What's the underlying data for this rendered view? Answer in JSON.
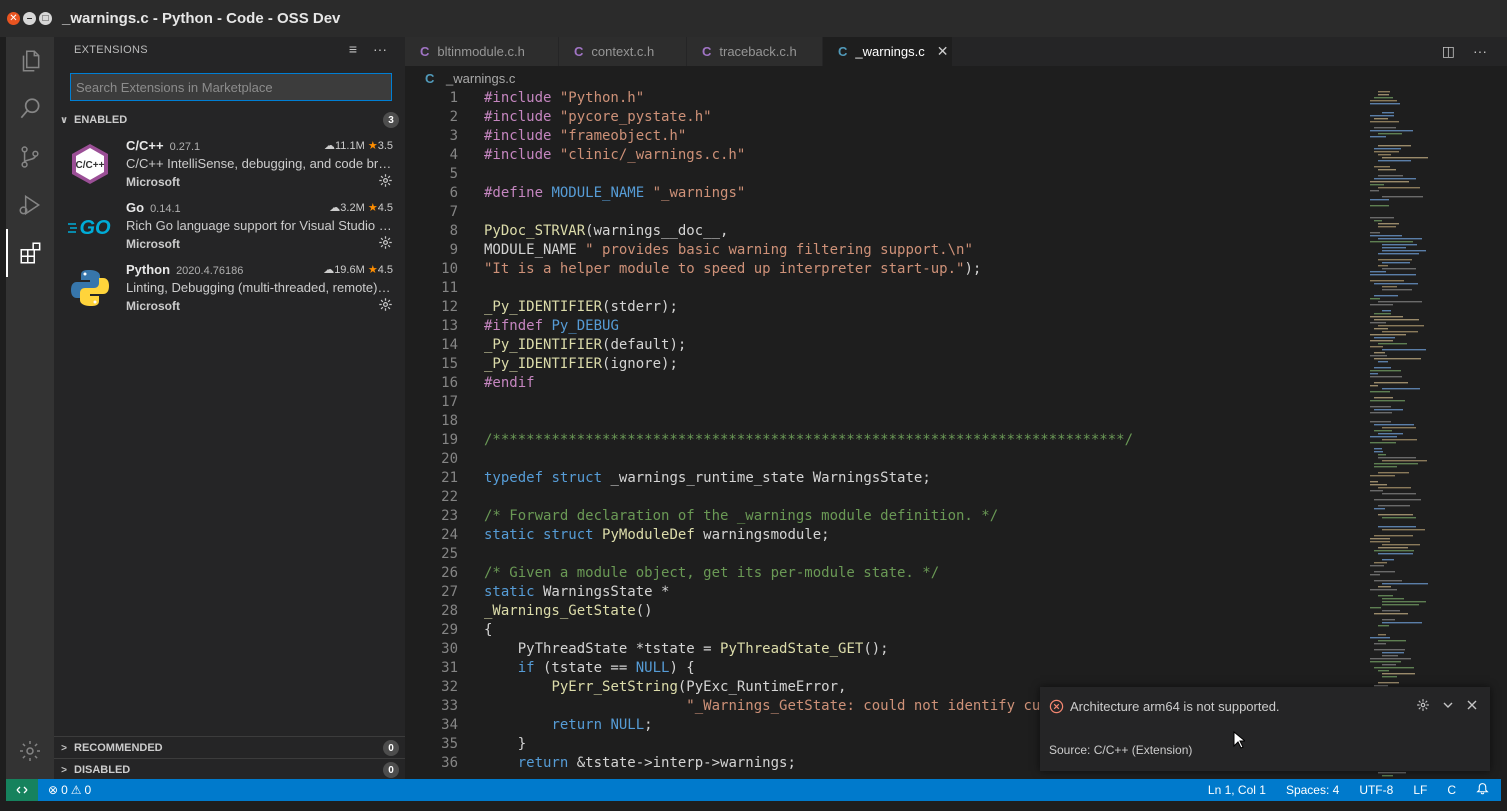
{
  "window": {
    "title": "_warnings.c - Python - Code - OSS Dev"
  },
  "activity_bar": {
    "items": [
      "explorer-icon",
      "search-icon",
      "source-control-icon",
      "run-debug-icon",
      "extensions-icon"
    ],
    "bottom": "manage-gear-icon"
  },
  "sidebar": {
    "header": "EXTENSIONS",
    "search_placeholder": "Search Extensions in Marketplace",
    "sections": {
      "enabled": {
        "label": "ENABLED",
        "count": "3"
      },
      "recommended": {
        "label": "RECOMMENDED",
        "count": "0"
      },
      "disabled": {
        "label": "DISABLED",
        "count": "0"
      }
    },
    "extensions": [
      {
        "name": "C/C++",
        "version": "0.27.1",
        "downloads": "11.1M",
        "rating": "3.5",
        "description": "C/C++ IntelliSense, debugging, and code browsing.",
        "publisher": "Microsoft",
        "icon_text": "C/C++"
      },
      {
        "name": "Go",
        "version": "0.14.1",
        "downloads": "3.2M",
        "rating": "4.5",
        "description": "Rich Go language support for Visual Studio Code",
        "publisher": "Microsoft",
        "icon_text": "GO"
      },
      {
        "name": "Python",
        "version": "2020.4.76186",
        "downloads": "19.6M",
        "rating": "4.5",
        "description": "Linting, Debugging (multi-threaded, remote), Intellisense",
        "publisher": "Microsoft",
        "icon_text": ""
      }
    ]
  },
  "editor": {
    "tabs": [
      {
        "label": "bltinmodule.c.h",
        "active": false
      },
      {
        "label": "context.c.h",
        "active": false
      },
      {
        "label": "traceback.c.h",
        "active": false
      },
      {
        "label": "_warnings.c",
        "active": true
      }
    ],
    "tab_glyph": "C",
    "close_glyph": "✕",
    "breadcrumb": "_warnings.c",
    "lines": [
      [
        "1",
        [
          [
            "pp",
            "#include "
          ],
          [
            "str",
            "\"Python.h\""
          ]
        ]
      ],
      [
        "2",
        [
          [
            "pp",
            "#include "
          ],
          [
            "str",
            "\"pycore_pystate.h\""
          ]
        ]
      ],
      [
        "3",
        [
          [
            "pp",
            "#include "
          ],
          [
            "str",
            "\"frameobject.h\""
          ]
        ]
      ],
      [
        "4",
        [
          [
            "pp",
            "#include "
          ],
          [
            "str",
            "\"clinic/_warnings.c.h\""
          ]
        ]
      ],
      [
        "5",
        []
      ],
      [
        "6",
        [
          [
            "pp",
            "#define "
          ],
          [
            "mac",
            "MODULE_NAME"
          ],
          [
            "txt",
            " "
          ],
          [
            "str",
            "\"_warnings\""
          ]
        ]
      ],
      [
        "7",
        []
      ],
      [
        "8",
        [
          [
            "fn",
            "PyDoc_STRVAR"
          ],
          [
            "txt",
            "(warnings__doc__,"
          ]
        ]
      ],
      [
        "9",
        [
          [
            "txt",
            "MODULE_NAME "
          ],
          [
            "str",
            "\" provides basic warning filtering support.\\n\""
          ]
        ]
      ],
      [
        "10",
        [
          [
            "str",
            "\"It is a helper module to speed up interpreter start-up.\""
          ],
          [
            "txt",
            ");"
          ]
        ]
      ],
      [
        "11",
        []
      ],
      [
        "12",
        [
          [
            "fn",
            "_Py_IDENTIFIER"
          ],
          [
            "txt",
            "(stderr);"
          ]
        ]
      ],
      [
        "13",
        [
          [
            "pp",
            "#ifndef "
          ],
          [
            "mac",
            "Py_DEBUG"
          ]
        ]
      ],
      [
        "14",
        [
          [
            "fn",
            "_Py_IDENTIFIER"
          ],
          [
            "txt",
            "(default);"
          ]
        ]
      ],
      [
        "15",
        [
          [
            "fn",
            "_Py_IDENTIFIER"
          ],
          [
            "txt",
            "(ignore);"
          ]
        ]
      ],
      [
        "16",
        [
          [
            "pp",
            "#endif"
          ]
        ]
      ],
      [
        "17",
        []
      ],
      [
        "18",
        []
      ],
      [
        "19",
        [
          [
            "com",
            "/***************************************************************************/"
          ]
        ]
      ],
      [
        "20",
        []
      ],
      [
        "21",
        [
          [
            "kw",
            "typedef"
          ],
          [
            "txt",
            " "
          ],
          [
            "kw",
            "struct"
          ],
          [
            "txt",
            " _warnings_runtime_state WarningsState;"
          ]
        ]
      ],
      [
        "22",
        []
      ],
      [
        "23",
        [
          [
            "com",
            "/* Forward declaration of the _warnings module definition. */"
          ]
        ]
      ],
      [
        "24",
        [
          [
            "kw",
            "static"
          ],
          [
            "txt",
            " "
          ],
          [
            "kw",
            "struct"
          ],
          [
            "txt",
            " "
          ],
          [
            "fn",
            "PyModuleDef"
          ],
          [
            "txt",
            " warningsmodule;"
          ]
        ]
      ],
      [
        "25",
        []
      ],
      [
        "26",
        [
          [
            "com",
            "/* Given a module object, get its per-module state. */"
          ]
        ]
      ],
      [
        "27",
        [
          [
            "kw",
            "static"
          ],
          [
            "txt",
            " WarningsState *"
          ]
        ]
      ],
      [
        "28",
        [
          [
            "fn",
            "_Warnings_GetState"
          ],
          [
            "txt",
            "()"
          ]
        ]
      ],
      [
        "29",
        [
          [
            "txt",
            "{"
          ]
        ]
      ],
      [
        "30",
        [
          [
            "txt",
            "    PyThreadState *tstate = "
          ],
          [
            "fn",
            "PyThreadState_GET"
          ],
          [
            "txt",
            "();"
          ]
        ]
      ],
      [
        "31",
        [
          [
            "txt",
            "    "
          ],
          [
            "kw",
            "if"
          ],
          [
            "txt",
            " (tstate == "
          ],
          [
            "kw",
            "NULL"
          ],
          [
            "txt",
            ") {"
          ]
        ]
      ],
      [
        "32",
        [
          [
            "txt",
            "        "
          ],
          [
            "fn",
            "PyErr_SetString"
          ],
          [
            "txt",
            "(PyExc_RuntimeError,"
          ]
        ]
      ],
      [
        "33",
        [
          [
            "txt",
            "                        "
          ],
          [
            "str",
            "\"_Warnings_GetState: could not identify current interpreter\""
          ],
          [
            "txt",
            ");"
          ]
        ]
      ],
      [
        "34",
        [
          [
            "txt",
            "        "
          ],
          [
            "kw",
            "return"
          ],
          [
            "txt",
            " "
          ],
          [
            "kw",
            "NULL"
          ],
          [
            "txt",
            ";"
          ]
        ]
      ],
      [
        "35",
        [
          [
            "txt",
            "    }"
          ]
        ]
      ],
      [
        "36",
        [
          [
            "txt",
            "    "
          ],
          [
            "kw",
            "return"
          ],
          [
            "txt",
            " &tstate->interp->warnings;"
          ]
        ]
      ]
    ]
  },
  "notification": {
    "message": "Architecture arm64 is not supported.",
    "source": "Source: C/C++ (Extension)"
  },
  "status_bar": {
    "errors": "0",
    "warnings": "0",
    "position": "Ln 1, Col 1",
    "spaces": "Spaces: 4",
    "encoding": "UTF-8",
    "eol": "LF",
    "language": "C"
  },
  "colors": {
    "accent": "#007acc",
    "remote": "#16825d",
    "star": "#ff8e00"
  }
}
